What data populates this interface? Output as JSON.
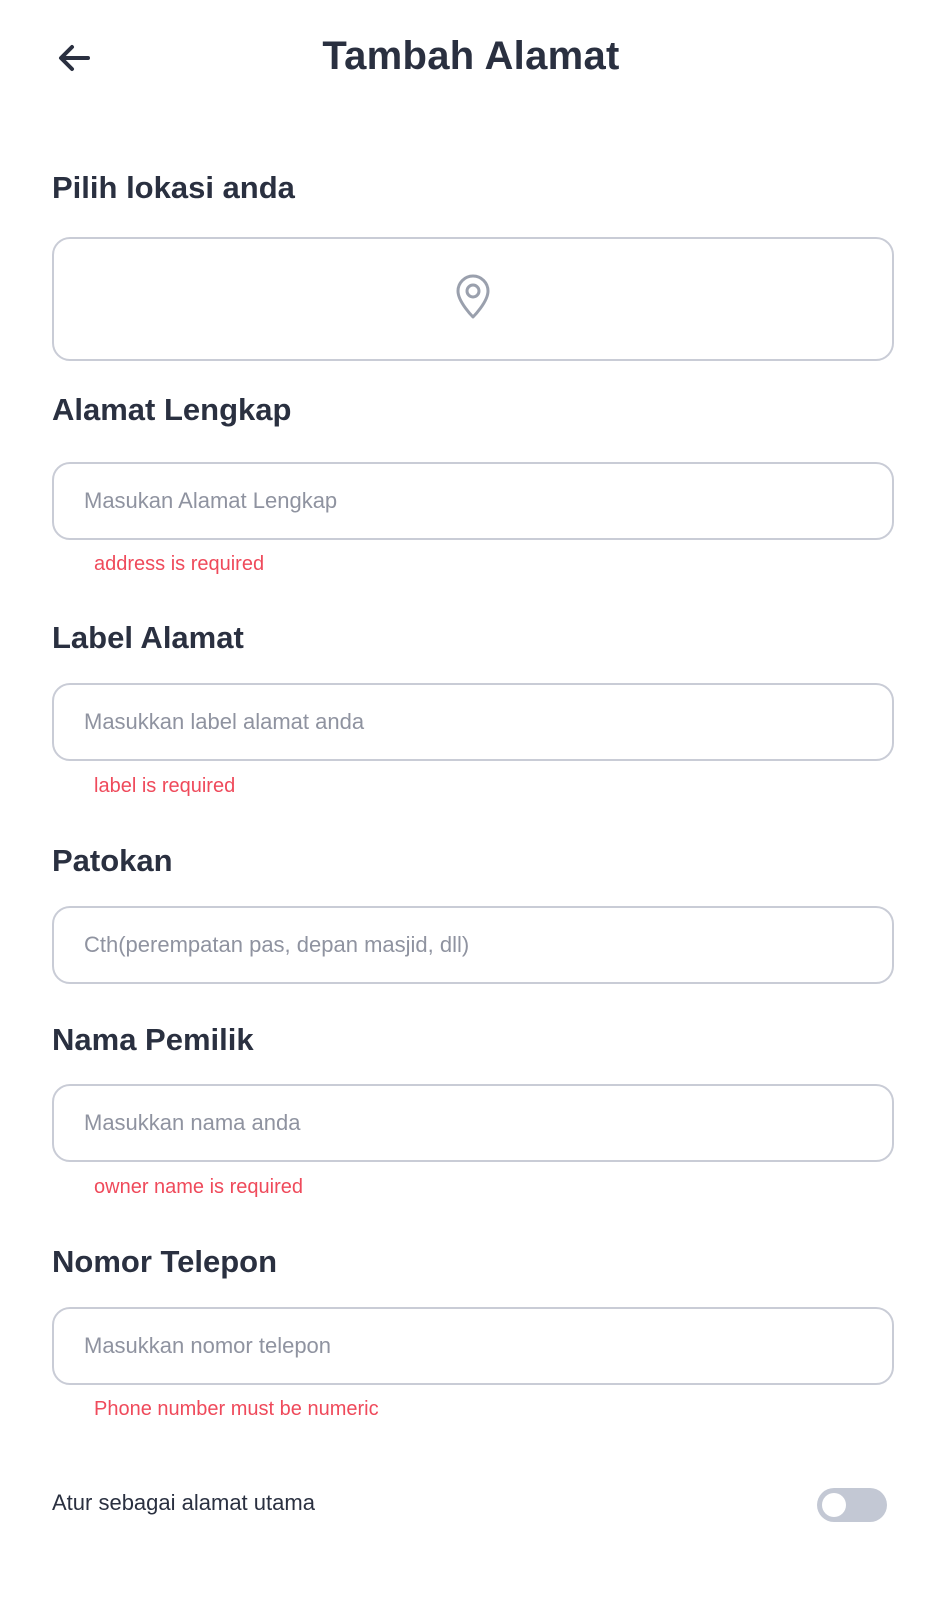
{
  "header": {
    "title": "Tambah Alamat",
    "back_icon": "arrow-left-icon"
  },
  "location": {
    "label": "Pilih lokasi anda",
    "icon": "map-pin-icon"
  },
  "address": {
    "label": "Alamat Lengkap",
    "placeholder": "Masukan Alamat Lengkap",
    "value": "",
    "error": "address is required"
  },
  "address_label": {
    "label": "Label Alamat",
    "placeholder": "Masukkan label alamat anda",
    "value": "",
    "error": "label is required"
  },
  "landmark": {
    "label": "Patokan",
    "placeholder": "Cth(perempatan pas, depan masjid, dll)",
    "value": ""
  },
  "owner": {
    "label": "Nama Pemilik",
    "placeholder": "Masukkan nama anda",
    "value": "",
    "error": "owner name is required"
  },
  "phone": {
    "label": "Nomor Telepon",
    "placeholder": "Masukkan nomor telepon",
    "value": "",
    "error": "Phone number must be numeric"
  },
  "primary": {
    "label": "Atur sebagai alamat utama",
    "enabled": false
  },
  "colors": {
    "error": "#ef4a5b",
    "border": "#c9ccd6",
    "text": "#2a3040",
    "toggle_off": "#c3c8d4"
  }
}
